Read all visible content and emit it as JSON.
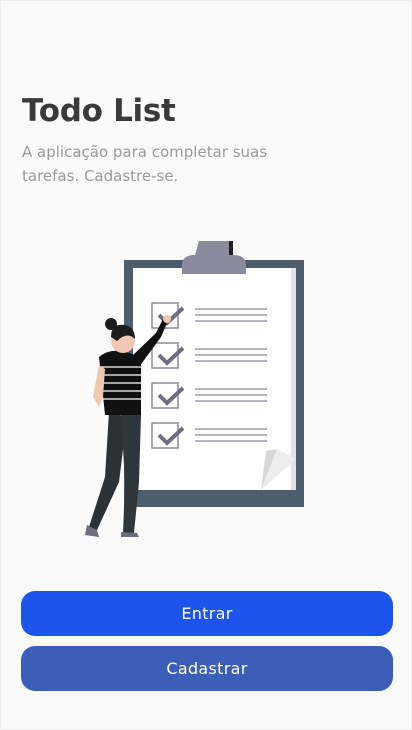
{
  "header": {
    "title": "Todo List",
    "subtitle": "A aplicação para completar suas tarefas. Cadastre-se."
  },
  "illustration": {
    "icon": "checklist-illustration",
    "checked_items": 4
  },
  "actions": {
    "login_label": "Entrar",
    "register_label": "Cadastrar"
  },
  "colors": {
    "background": "#fafafa",
    "title": "#3a3a3a",
    "subtitle": "#9a9a9a",
    "primary_button": "#1d55ec",
    "secondary_button": "#3b5fb9"
  }
}
